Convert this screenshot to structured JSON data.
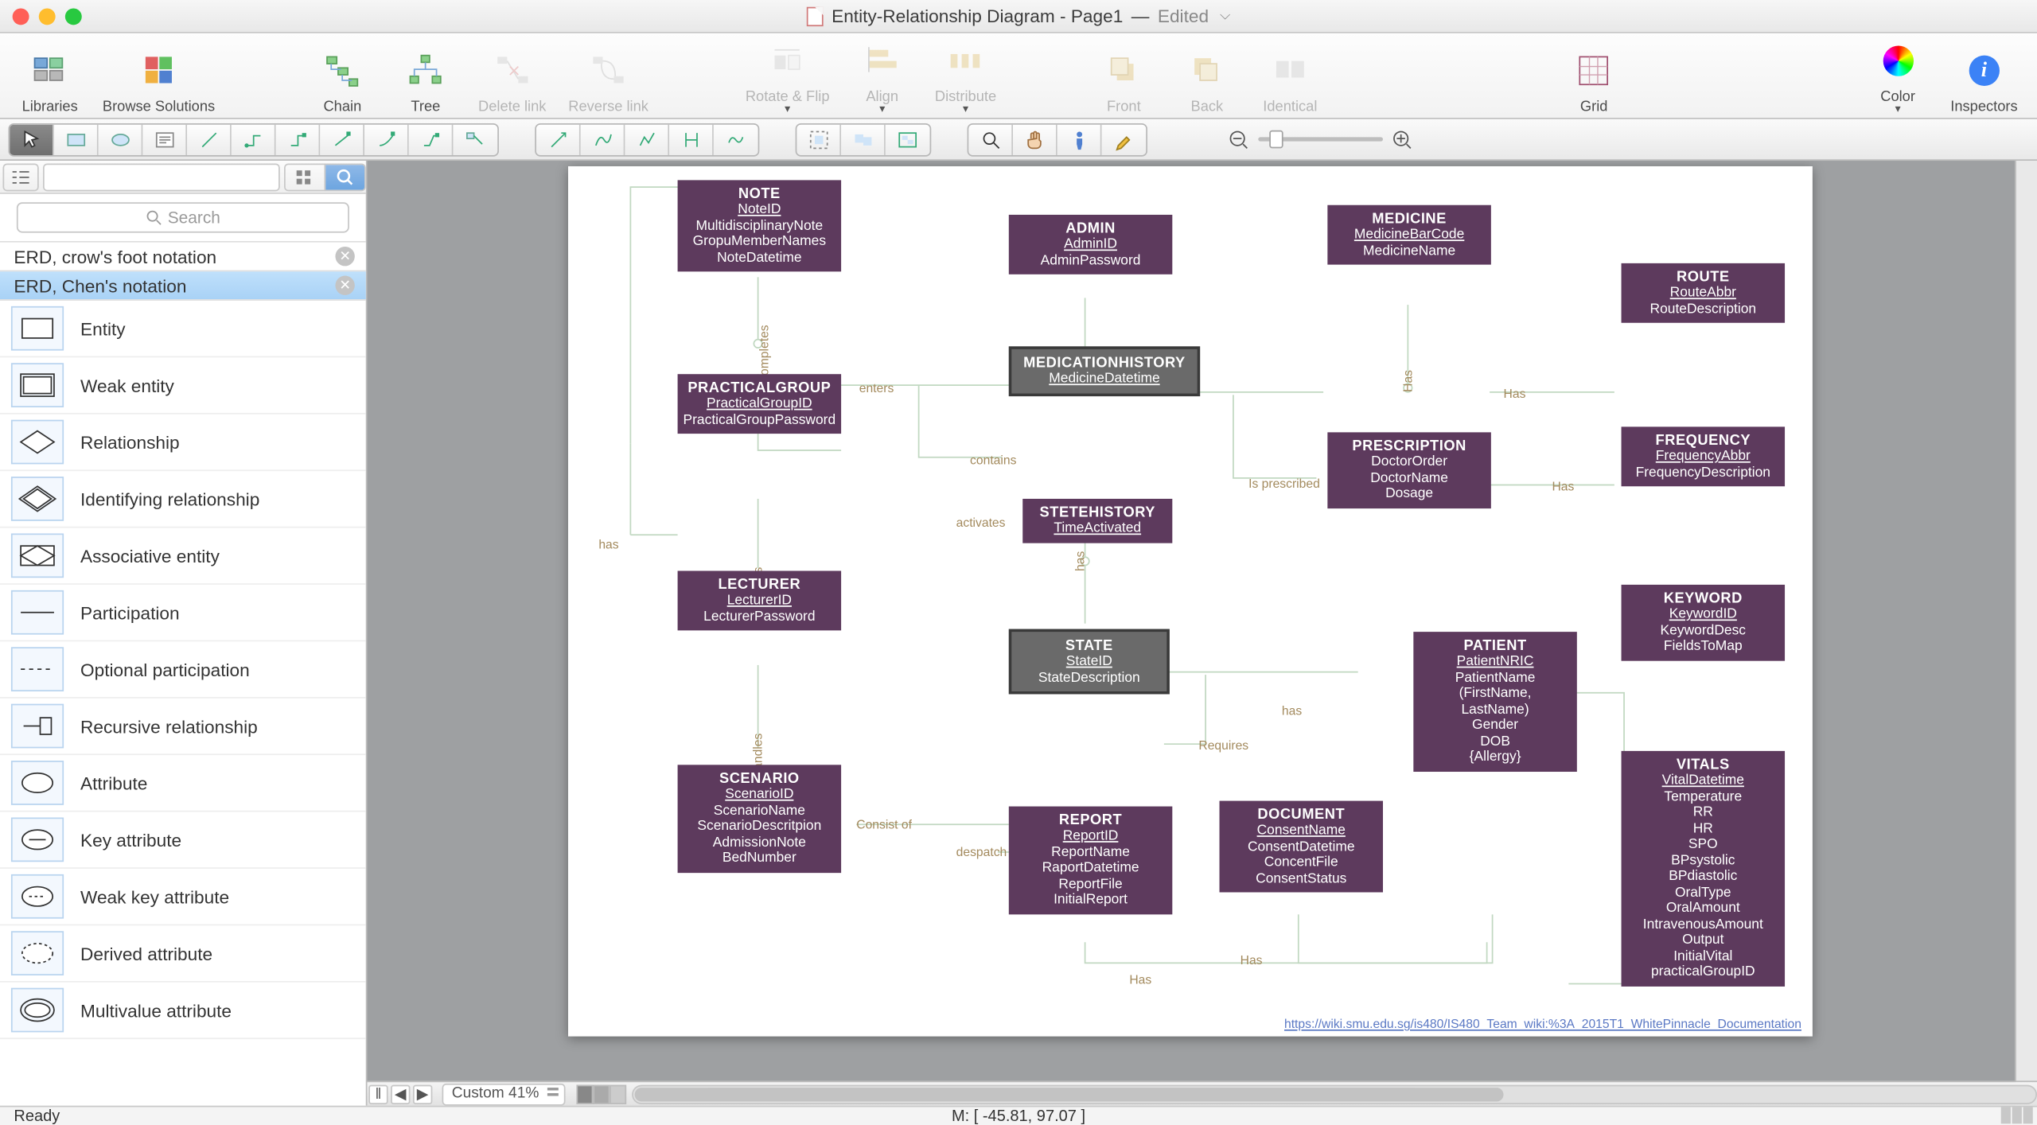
{
  "window": {
    "title_main": "Entity-Relationship Diagram - Page1",
    "title_sep": " — ",
    "title_state": "Edited"
  },
  "toolbar": {
    "libraries": "Libraries",
    "browse": "Browse Solutions",
    "chain": "Chain",
    "tree": "Tree",
    "delete_link": "Delete link",
    "reverse_link": "Reverse link",
    "rotate": "Rotate & Flip",
    "align": "Align",
    "distribute": "Distribute",
    "front": "Front",
    "back": "Back",
    "identical": "Identical",
    "grid": "Grid",
    "color": "Color",
    "inspectors": "Inspectors"
  },
  "library": {
    "search_placeholder": "Search",
    "cat1": "ERD, crow's foot notation",
    "cat2": "ERD, Chen's notation",
    "items": [
      "Entity",
      "Weak entity",
      "Relationship",
      "Identifying relationship",
      "Associative entity",
      "Participation",
      "Optional participation",
      "Recursive relationship",
      "Attribute",
      "Key attribute",
      "Weak key attribute",
      "Derived attribute",
      "Multivalue attribute"
    ]
  },
  "entities": {
    "note": {
      "title": "NOTE",
      "k": "NoteID",
      "a1": "MultidisciplinaryNote",
      "a2": "GropuMemberNames",
      "a3": "NoteDatetime"
    },
    "admin": {
      "title": "ADMIN",
      "k": "AdminID",
      "a1": "AdminPassword"
    },
    "medicine": {
      "title": "MEDICINE",
      "k": "MedicineBarCode",
      "a1": "MedicineName"
    },
    "route": {
      "title": "ROUTE",
      "k": "RouteAbbr",
      "a1": "RouteDescription"
    },
    "practical": {
      "title": "PRACTICALGROUP",
      "k": "PracticalGroupID",
      "a1": "PracticalGroupPassword"
    },
    "medhist": {
      "title": "MEDICATIONHISTORY",
      "k": "MedicineDatetime"
    },
    "prescription": {
      "title": "PRESCRIPTION",
      "a1": "DoctorOrder",
      "a2": "DoctorName",
      "a3": "Dosage"
    },
    "frequency": {
      "title": "FREQUENCY",
      "k": "FrequencyAbbr",
      "a1": "FrequencyDescription"
    },
    "lecturer": {
      "title": "LECTURER",
      "k": "LecturerID",
      "a1": "LecturerPassword"
    },
    "stetehist": {
      "title": "STETEHISTORY",
      "k": "TimeActivated"
    },
    "state": {
      "title": "STATE",
      "k": "StateID",
      "a1": "StateDescription"
    },
    "keyword": {
      "title": "KEYWORD",
      "k": "KeywordID",
      "a1": "KeywordDesc",
      "a2": "FieldsToMap"
    },
    "scenario": {
      "title": "SCENARIO",
      "k": "ScenarioID",
      "a1": "ScenarioName",
      "a2": "ScenarioDescritpion",
      "a3": "AdmissionNote",
      "a4": "BedNumber"
    },
    "patient": {
      "title": "PATIENT",
      "k": "PatientNRIC",
      "a1": "PatientName",
      "a2": "(FirstName,",
      "a3": "LastName)",
      "a4": "Gender",
      "a5": "DOB",
      "a6": "{Allergy}"
    },
    "report": {
      "title": "REPORT",
      "k": "ReportID",
      "a1": "ReportName",
      "a2": "RaportDatetime",
      "a3": "ReportFile",
      "a4": "InitialReport"
    },
    "document": {
      "title": "DOCUMENT",
      "k": "ConsentName",
      "a1": "ConsentDatetime",
      "a2": "ConcentFile",
      "a3": "ConsentStatus"
    },
    "vitals": {
      "title": "VITALS",
      "k": "VitalDatetime",
      "a1": "Temperature",
      "a2": "RR",
      "a3": "HR",
      "a4": "SPO",
      "a5": "BPsystolic",
      "a6": "BPdiastolic",
      "a7": "OralType",
      "a8": "OralAmount",
      "a9": "IntravenousAmount",
      "a10": "Output",
      "a11": "InitialVital",
      "a12": "practicalGroupID"
    }
  },
  "edges": {
    "has1": "has",
    "completes": "completes",
    "enters": "enters",
    "contains": "contains",
    "activates": "activates",
    "handles": "handles",
    "handles2": "handles",
    "has_mh": "Has",
    "has_pr": "Has",
    "is_prescribed": "Is prescribed",
    "has_freq": "Has",
    "has_state": "has",
    "consist": "Consist of",
    "despatch": "despatch",
    "requires": "Requires",
    "has_pat": "has",
    "has_doc": "Has",
    "has_vitals": "Has",
    "has_vitals2": "Has"
  },
  "canvas": {
    "wiki": "https://wiki.smu.edu.sg/is480/IS480_Team_wiki:%3A_2015T1_WhitePinnacle_Documentation"
  },
  "bottom": {
    "zoom": "Custom 41%"
  },
  "status": {
    "ready": "Ready",
    "coords": "M: [ -45.81, 97.07 ]"
  }
}
